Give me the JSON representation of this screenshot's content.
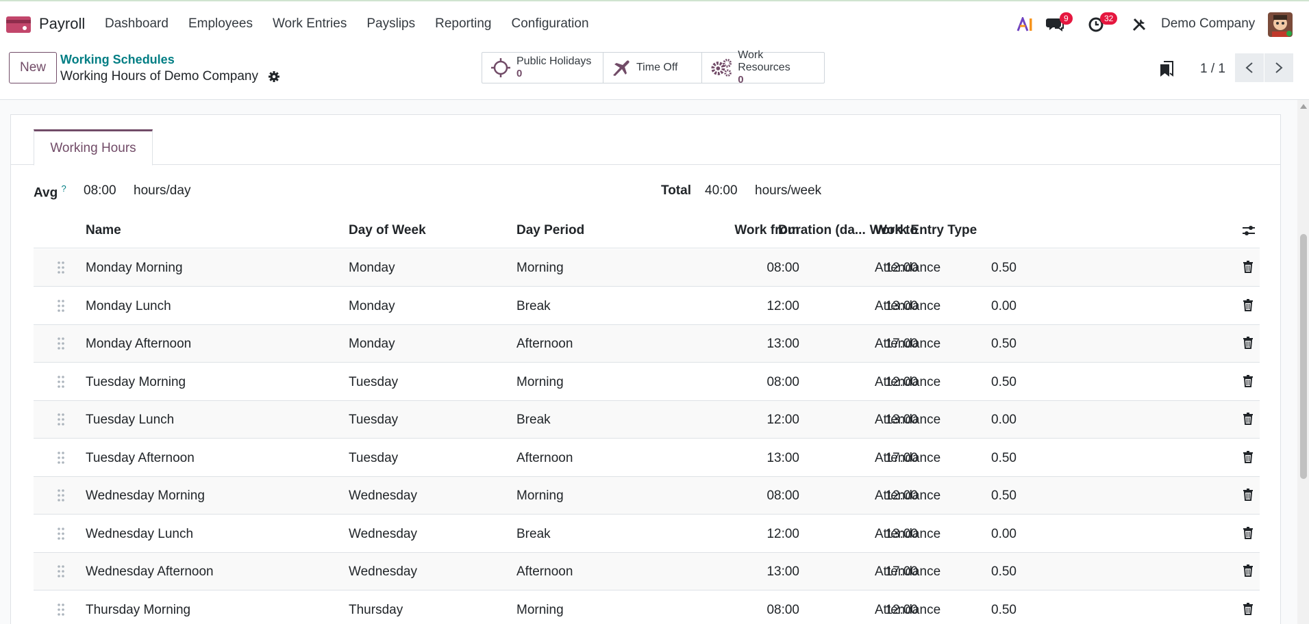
{
  "app": {
    "name": "Payroll",
    "menu": [
      "Dashboard",
      "Employees",
      "Work Entries",
      "Payslips",
      "Reporting",
      "Configuration"
    ],
    "messages_badge": "9",
    "activities_badge": "32",
    "company": "Demo Company",
    "brand_color": "#714b67",
    "link_color": "#017e84",
    "badge_color": "#e5173f"
  },
  "control": {
    "new_label": "New",
    "breadcrumb_parent": "Working Schedules",
    "breadcrumb_current": "Working Hours of Demo Company",
    "smart_buttons": [
      {
        "label": "Public Holidays",
        "count": "0",
        "icon": "sun-icon"
      },
      {
        "label": "Time Off",
        "count": "",
        "icon": "plane-icon"
      },
      {
        "label": "Work Resources",
        "count": "0",
        "icon": "gears-icon"
      }
    ],
    "pager": "1 / 1"
  },
  "form": {
    "tab": "Working Hours",
    "avg_label": "Avg",
    "avg_help": "?",
    "avg_value": "08:00",
    "avg_unit": "hours/day",
    "total_label": "Total",
    "total_value": "40:00",
    "total_unit": "hours/week"
  },
  "table": {
    "headers": {
      "name": "Name",
      "day": "Day of Week",
      "period": "Day Period",
      "from": "Work from",
      "to": "Work to",
      "duration": "Duration (da...",
      "type": "Work Entry Type"
    },
    "rows": [
      {
        "name": "Monday Morning",
        "day": "Monday",
        "period": "Morning",
        "from": "08:00",
        "to": "12:00",
        "duration": "0.50",
        "type": "Attendance"
      },
      {
        "name": "Monday Lunch",
        "day": "Monday",
        "period": "Break",
        "from": "12:00",
        "to": "13:00",
        "duration": "0.00",
        "type": "Attendance"
      },
      {
        "name": "Monday Afternoon",
        "day": "Monday",
        "period": "Afternoon",
        "from": "13:00",
        "to": "17:00",
        "duration": "0.50",
        "type": "Attendance"
      },
      {
        "name": "Tuesday Morning",
        "day": "Tuesday",
        "period": "Morning",
        "from": "08:00",
        "to": "12:00",
        "duration": "0.50",
        "type": "Attendance"
      },
      {
        "name": "Tuesday Lunch",
        "day": "Tuesday",
        "period": "Break",
        "from": "12:00",
        "to": "13:00",
        "duration": "0.00",
        "type": "Attendance"
      },
      {
        "name": "Tuesday Afternoon",
        "day": "Tuesday",
        "period": "Afternoon",
        "from": "13:00",
        "to": "17:00",
        "duration": "0.50",
        "type": "Attendance"
      },
      {
        "name": "Wednesday Morning",
        "day": "Wednesday",
        "period": "Morning",
        "from": "08:00",
        "to": "12:00",
        "duration": "0.50",
        "type": "Attendance"
      },
      {
        "name": "Wednesday Lunch",
        "day": "Wednesday",
        "period": "Break",
        "from": "12:00",
        "to": "13:00",
        "duration": "0.00",
        "type": "Attendance"
      },
      {
        "name": "Wednesday Afternoon",
        "day": "Wednesday",
        "period": "Afternoon",
        "from": "13:00",
        "to": "17:00",
        "duration": "0.50",
        "type": "Attendance"
      },
      {
        "name": "Thursday Morning",
        "day": "Thursday",
        "period": "Morning",
        "from": "08:00",
        "to": "12:00",
        "duration": "0.50",
        "type": "Attendance"
      }
    ]
  }
}
